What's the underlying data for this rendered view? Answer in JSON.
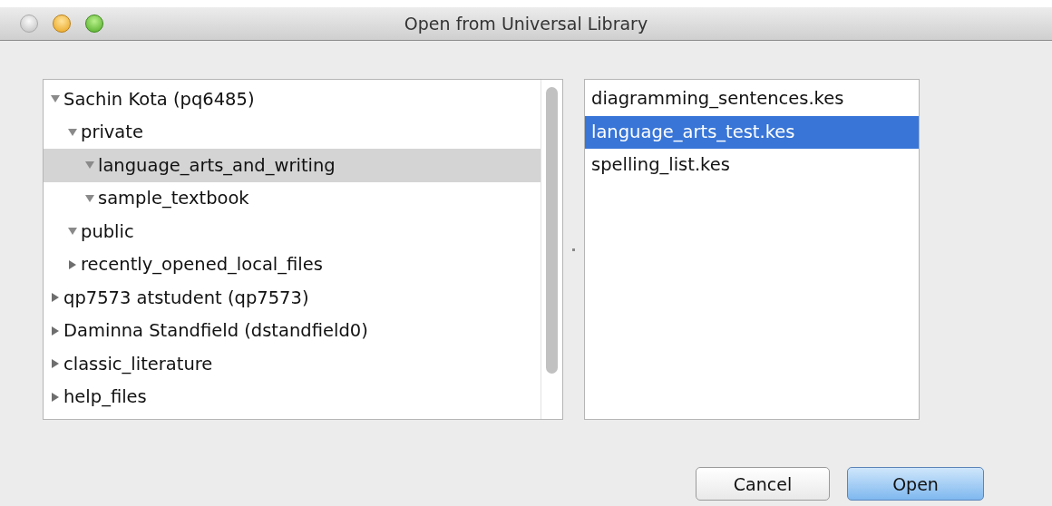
{
  "window": {
    "title": "Open from Universal Library"
  },
  "tree": [
    {
      "label": "Sachin Kota (pq6485)",
      "expanded": true,
      "selected": false,
      "children": [
        {
          "label": "private",
          "expanded": true,
          "selected": false,
          "children": [
            {
              "label": "language_arts_and_writing",
              "expanded": true,
              "selected": true
            },
            {
              "label": "sample_textbook",
              "expanded": true,
              "selected": false
            }
          ]
        },
        {
          "label": "public",
          "expanded": true,
          "selected": false
        },
        {
          "label": "recently_opened_local_files",
          "expanded": false,
          "selected": false
        }
      ]
    },
    {
      "label": "qp7573 atstudent (qp7573)",
      "expanded": false,
      "selected": false
    },
    {
      "label": "Daminna Standfield (dstandfield0)",
      "expanded": false,
      "selected": false
    },
    {
      "label": "classic_literature",
      "expanded": false,
      "selected": false
    },
    {
      "label": "help_files",
      "expanded": false,
      "selected": false
    }
  ],
  "files": [
    {
      "name": "diagramming_sentences.kes",
      "selected": false
    },
    {
      "name": "language_arts_test.kes",
      "selected": true
    },
    {
      "name": "spelling_list.kes",
      "selected": false
    }
  ],
  "buttons": [
    {
      "label": "Cancel",
      "kind": "normal"
    },
    {
      "label": "Open",
      "kind": "default"
    }
  ]
}
